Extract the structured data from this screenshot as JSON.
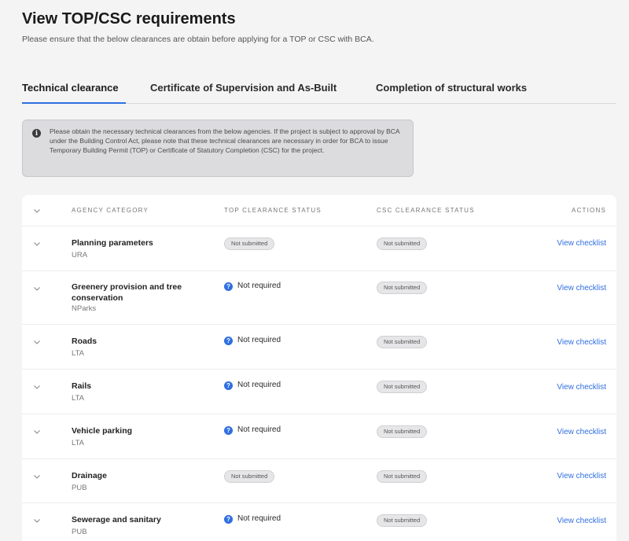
{
  "page": {
    "title": "View TOP/CSC requirements",
    "subtitle": "Please ensure that the below clearances are obtain before applying for a TOP or CSC with BCA."
  },
  "tabs": [
    {
      "label": "Technical clearance",
      "active": true
    },
    {
      "label": "Certificate of Supervision and As-Built",
      "active": false
    },
    {
      "label": "Completion of structural works",
      "active": false
    }
  ],
  "info": {
    "icon": "info-icon",
    "text": "Please obtain the necessary technical clearances from the below agencies. If the project is subject to approval by BCA under the Building Control Act, please note that these technical clearances are necessary in order for BCA to issue Temporary Building Permit (TOP) or Certificate of Statutory Completion (CSC) for the project."
  },
  "table": {
    "headers": {
      "agency_category": "AGENCY CATEGORY",
      "top_status": "TOP CLEARANCE STATUS",
      "csc_status": "CSC CLEARANCE STATUS",
      "actions": "ACTIONS"
    },
    "rows": [
      {
        "name": "Planning parameters",
        "agency": "URA",
        "top": "Not submitted",
        "csc": "Not submitted",
        "action": "View checklist"
      },
      {
        "name": "Greenery provision and tree conservation",
        "agency": "NParks",
        "top": "Not required",
        "csc": "Not submitted",
        "action": "View checklist"
      },
      {
        "name": "Roads",
        "agency": "LTA",
        "top": "Not required",
        "csc": "Not submitted",
        "action": "View checklist"
      },
      {
        "name": "Rails",
        "agency": "LTA",
        "top": "Not required",
        "csc": "Not submitted",
        "action": "View checklist"
      },
      {
        "name": "Vehicle parking",
        "agency": "LTA",
        "top": "Not required",
        "csc": "Not submitted",
        "action": "View checklist"
      },
      {
        "name": "Drainage",
        "agency": "PUB",
        "top": "Not submitted",
        "csc": "Not submitted",
        "action": "View checklist"
      },
      {
        "name": "Sewerage and sanitary",
        "agency": "PUB",
        "top": "Not required",
        "csc": "Not submitted",
        "action": "View checklist"
      }
    ]
  },
  "colors": {
    "accent": "#2f6fe0",
    "badge_bg": "#e6e6e8",
    "info_bg": "#dcdcdf"
  }
}
